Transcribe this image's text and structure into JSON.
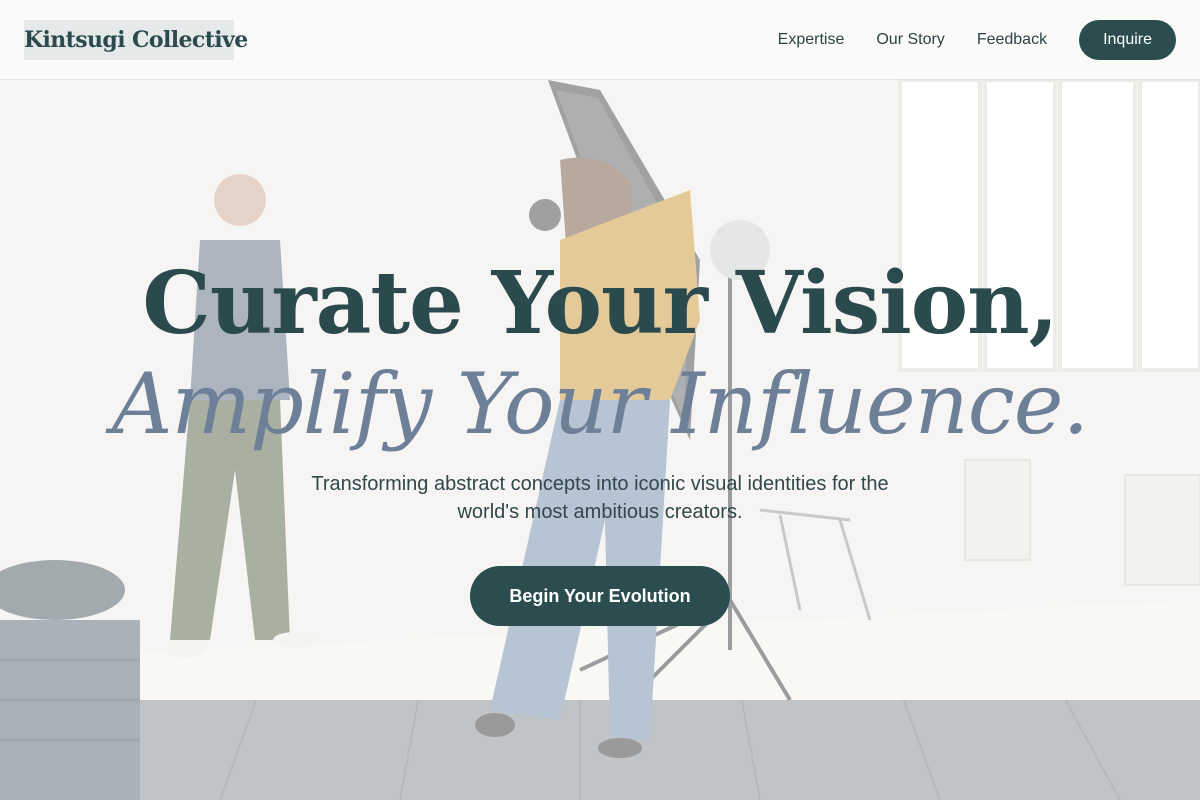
{
  "header": {
    "logo_text": "Kintsugi Collective",
    "nav": {
      "expertise": "Expertise",
      "our_story": "Our Story",
      "feedback": "Feedback"
    },
    "cta_label": "Inquire"
  },
  "hero": {
    "headline_line1": "Curate Your Vision,",
    "headline_line2": "Amplify Your Influence.",
    "subtitle": "Transforming abstract concepts into iconic visual identities for the world's most ambitious creators.",
    "cta_label": "Begin Your Evolution",
    "background_image": "photo-studio-scene"
  },
  "colors": {
    "primary": "#2b4d50",
    "headline": "#2b4a4d",
    "accent_italic": "#6e7f98",
    "header_bg": "#fafaf9"
  }
}
